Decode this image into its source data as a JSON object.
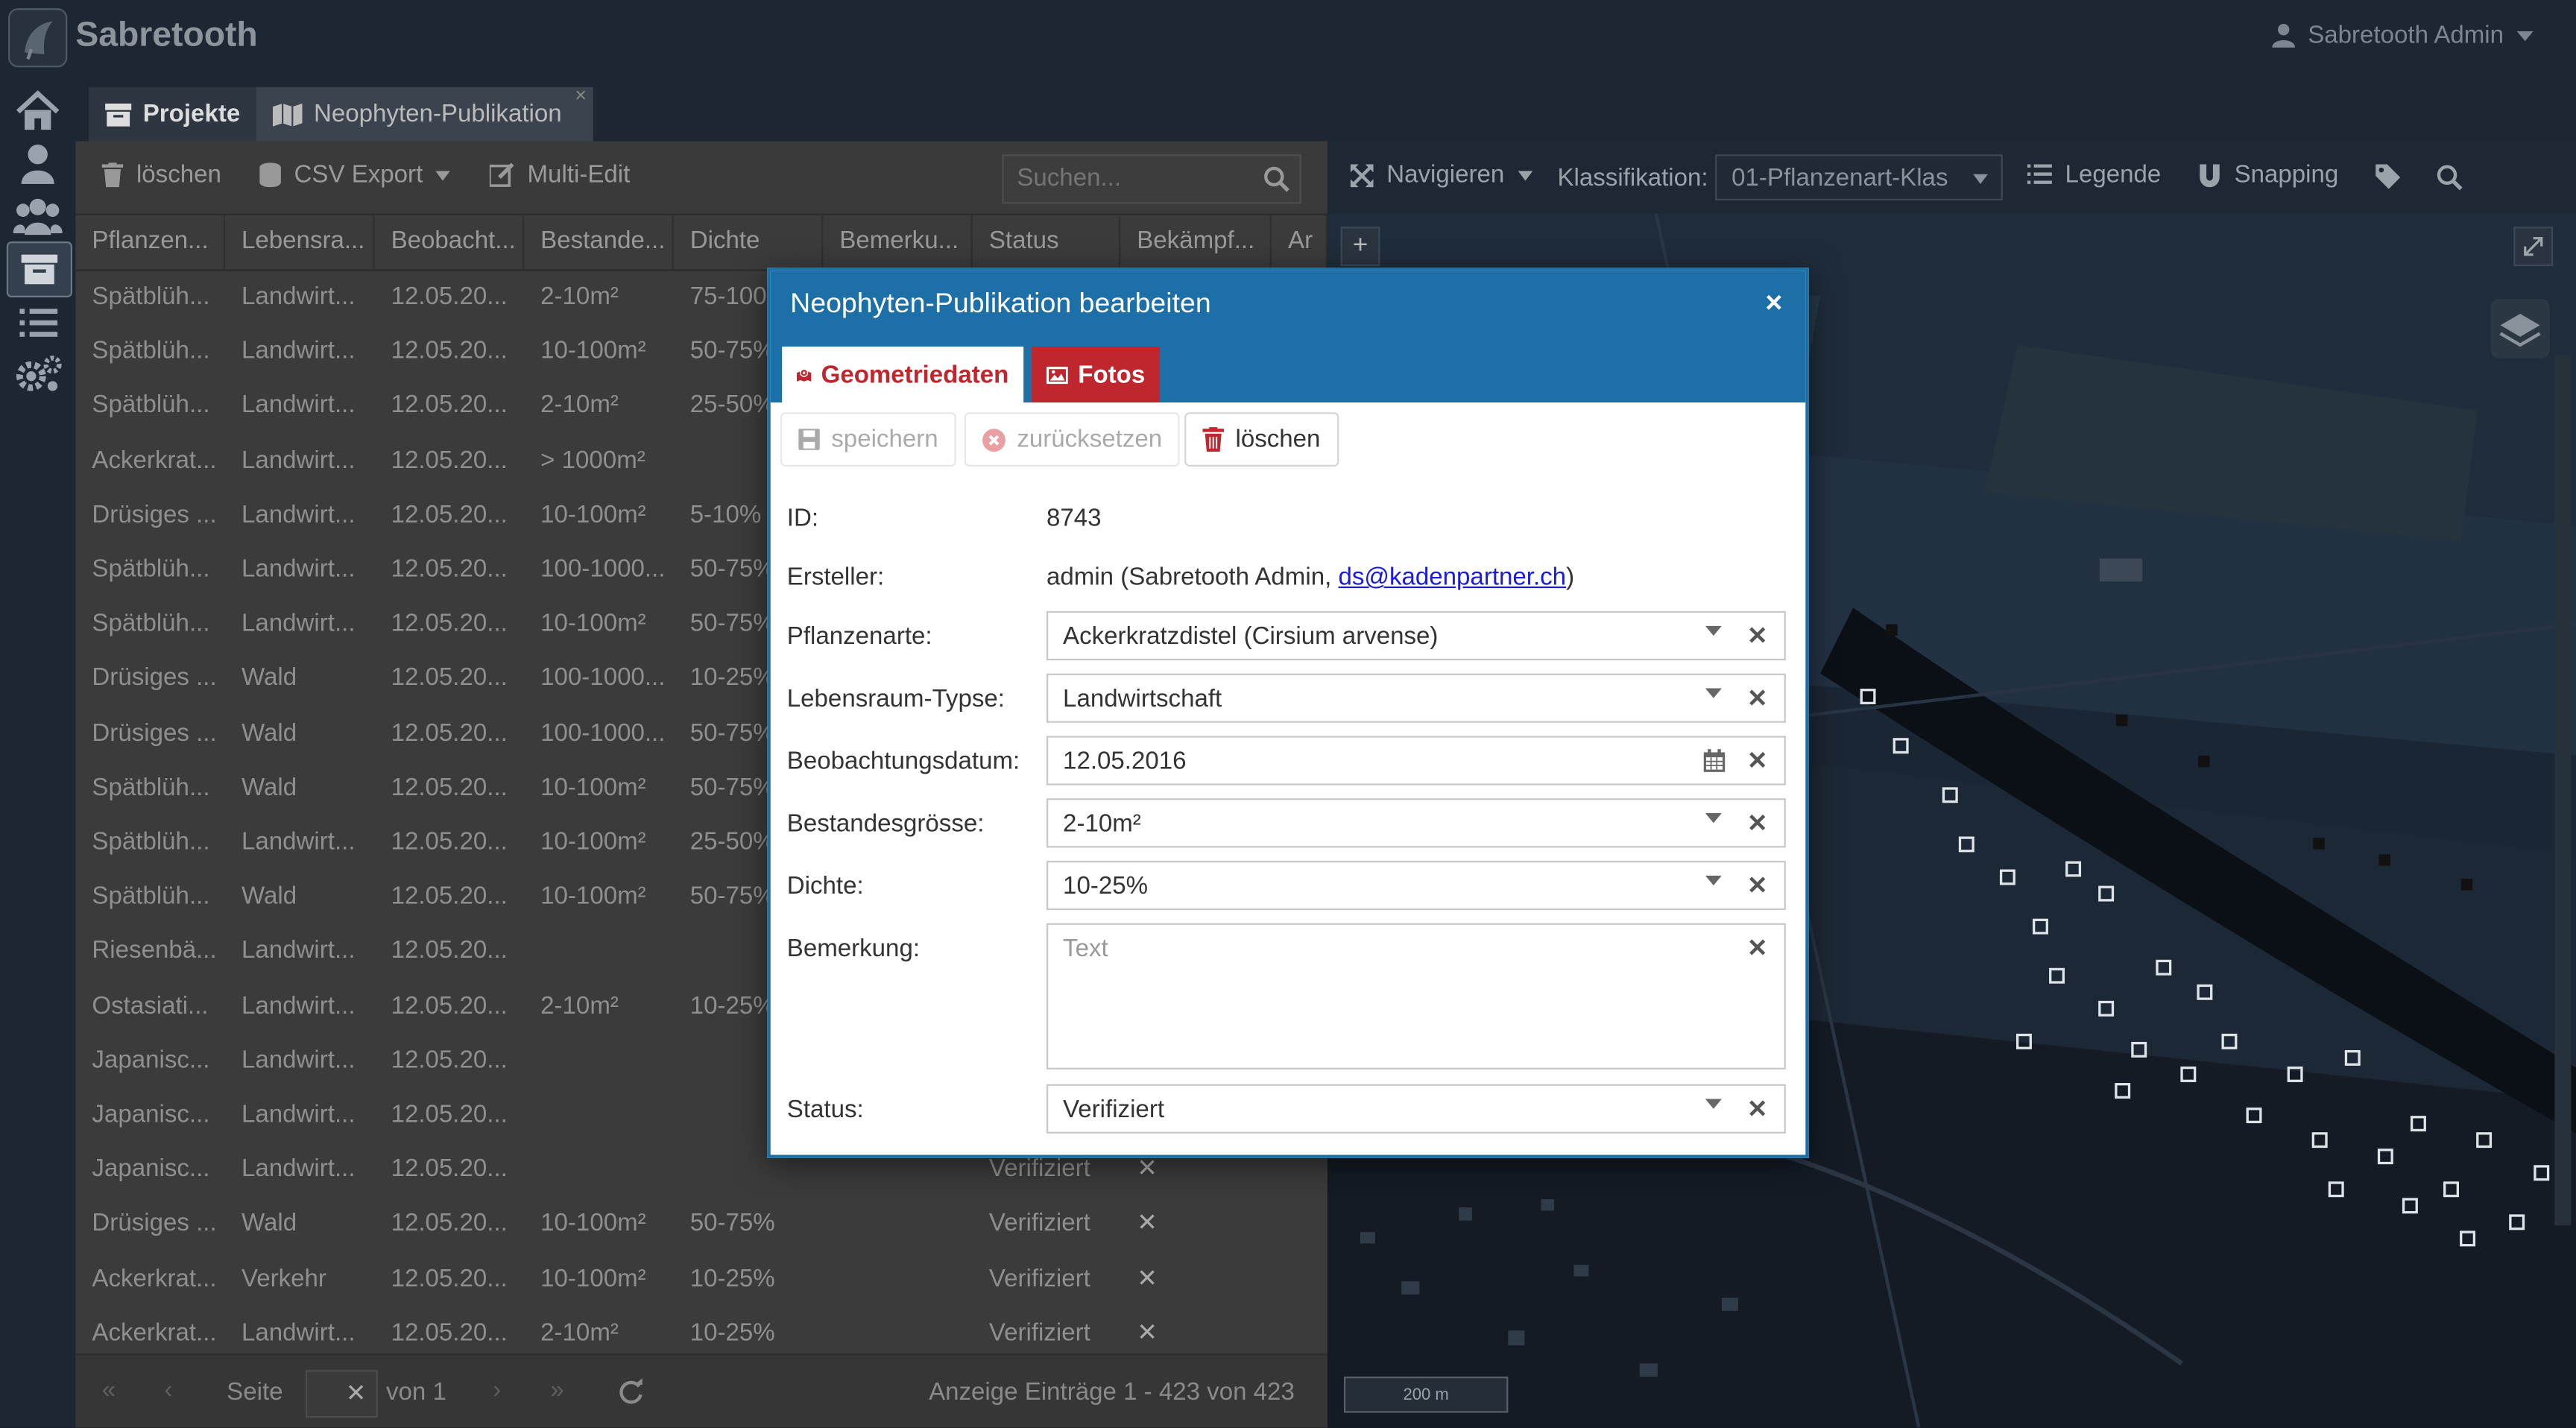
{
  "app": {
    "brand": "Sabretooth",
    "user": "Sabretooth Admin"
  },
  "tabs": [
    {
      "label": "Projekte",
      "icon": "archive-icon"
    },
    {
      "label": "Neophyten-Publikation",
      "icon": "map-icon",
      "close": "×"
    }
  ],
  "rail": [
    "home-icon",
    "user-icon",
    "users-icon",
    "archive-icon",
    "list-icon",
    "cogs-icon"
  ],
  "grid": {
    "toolbar": {
      "delete": "löschen",
      "csv": "CSV Export",
      "multi": "Multi-Edit",
      "search_placeholder": "Suchen..."
    },
    "columns": [
      "Pflanzen...",
      "Lebensra...",
      "Beobacht...",
      "Bestande...",
      "Dichte",
      "Bemerku...",
      "Status",
      "Bekämpf...",
      "Ar"
    ],
    "rows": [
      [
        "Spätblüh...",
        "Landwirt...",
        "12.05.20...",
        "2-10m²",
        "75-100",
        "",
        "",
        ""
      ],
      [
        "Spätblüh...",
        "Landwirt...",
        "12.05.20...",
        "10-100m²",
        "50-75%",
        "",
        "",
        ""
      ],
      [
        "Spätblüh...",
        "Landwirt...",
        "12.05.20...",
        "2-10m²",
        "25-50%",
        "",
        "",
        ""
      ],
      [
        "Ackerkrat...",
        "Landwirt...",
        "12.05.20...",
        "> 1000m²",
        "",
        "",
        "",
        ""
      ],
      [
        "Drüsiges ...",
        "Landwirt...",
        "12.05.20...",
        "10-100m²",
        "5-10%",
        "",
        "",
        ""
      ],
      [
        "Spätblüh...",
        "Landwirt...",
        "12.05.20...",
        "100-1000...",
        "50-75%",
        "",
        "",
        ""
      ],
      [
        "Spätblüh...",
        "Landwirt...",
        "12.05.20...",
        "10-100m²",
        "50-75%",
        "",
        "",
        ""
      ],
      [
        "Drüsiges ...",
        "Wald",
        "12.05.20...",
        "100-1000...",
        "10-25%",
        "",
        "",
        ""
      ],
      [
        "Drüsiges ...",
        "Wald",
        "12.05.20...",
        "100-1000...",
        "50-75%",
        "",
        "",
        ""
      ],
      [
        "Spätblüh...",
        "Wald",
        "12.05.20...",
        "10-100m²",
        "50-75%",
        "",
        "",
        ""
      ],
      [
        "Spätblüh...",
        "Landwirt...",
        "12.05.20...",
        "10-100m²",
        "25-50%",
        "",
        "",
        ""
      ],
      [
        "Spätblüh...",
        "Wald",
        "12.05.20...",
        "10-100m²",
        "50-75%",
        "",
        "",
        ""
      ],
      [
        "Riesenbä...",
        "Landwirt...",
        "12.05.20...",
        "",
        "",
        "",
        "",
        ""
      ],
      [
        "Ostasiati...",
        "Landwirt...",
        "12.05.20...",
        "2-10m²",
        "10-25%",
        "",
        "",
        ""
      ],
      [
        "Japanisc...",
        "Landwirt...",
        "12.05.20...",
        "",
        "",
        "",
        "",
        ""
      ],
      [
        "Japanisc...",
        "Landwirt...",
        "12.05.20...",
        "",
        "",
        "",
        "",
        ""
      ],
      [
        "Japanisc...",
        "Landwirt...",
        "12.05.20...",
        "",
        "",
        "",
        "Verifiziert",
        "✕"
      ],
      [
        "Drüsiges ...",
        "Wald",
        "12.05.20...",
        "10-100m²",
        "50-75%",
        "",
        "Verifiziert",
        "✕"
      ],
      [
        "Ackerkrat...",
        "Verkehr",
        "12.05.20...",
        "10-100m²",
        "10-25%",
        "",
        "Verifiziert",
        "✕"
      ],
      [
        "Ackerkrat...",
        "Landwirt...",
        "12.05.20...",
        "2-10m²",
        "10-25%",
        "",
        "Verifiziert",
        "✕"
      ]
    ],
    "footer": {
      "page_label": "Seite",
      "of_label": "von 1",
      "summary": "Anzeige Einträge 1 - 423 von 423"
    }
  },
  "map": {
    "toolbar": {
      "navigate": "Navigieren",
      "klass_label": "Klassifikation:",
      "klass_value": "01-Pflanzenart-Klas",
      "legend": "Legende",
      "snapping": "Snapping"
    },
    "zoom_in": "+",
    "scale": "200 m"
  },
  "dialog": {
    "title": "Neophyten-Publikation bearbeiten",
    "close": "×",
    "tabs": {
      "geo": "Geometriedaten",
      "fotos": "Fotos"
    },
    "actions": {
      "save": "speichern",
      "reset": "zurücksetzen",
      "delete": "löschen"
    },
    "fields": {
      "id_label": "ID:",
      "id_value": "8743",
      "creator_label": "Ersteller:",
      "creator_prefix": "admin (Sabretooth Admin, ",
      "creator_email": "ds@kadenpartner.ch",
      "creator_suffix": ")",
      "plant_label": "Pflanzenarte:",
      "plant_value": "Ackerkratzdistel (Cirsium arvense)",
      "habitat_label": "Lebensraum-Typse:",
      "habitat_value": "Landwirtschaft",
      "date_label": "Beobachtungsdatum:",
      "date_value": "12.05.2016",
      "stock_label": "Bestandesgrösse:",
      "stock_value": "2-10m²",
      "density_label": "Dichte:",
      "density_value": "10-25%",
      "note_label": "Bemerkung:",
      "note_placeholder": "Text",
      "status_label": "Status:",
      "status_value": "Verifiziert"
    }
  }
}
